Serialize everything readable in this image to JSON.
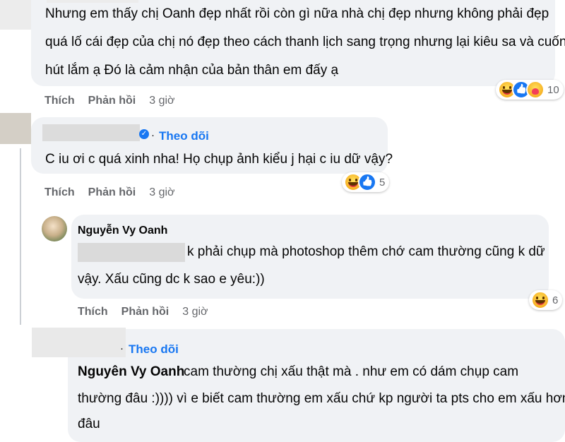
{
  "comments": [
    {
      "lines": [
        "Nhưng em thấy chị Oanh đẹp nhất rồi còn gì nữa nhà chị đẹp nhưng không phải đẹp",
        "quá lố cái đẹp của chị nó đẹp theo cách thanh lịch sang trọng nhưng lại kiêu sa và cuốn",
        "hút lắm ạ Đó là cảm nhận của bản thân em đấy ạ"
      ],
      "actions": {
        "like": "Thích",
        "reply": "Phản hồi",
        "time": "3 giờ"
      },
      "reactions": {
        "icons": [
          "haha-icon",
          "like-icon",
          "care-icon"
        ],
        "count": "10"
      }
    },
    {
      "follow": "Theo dõi",
      "text": "C iu ơi c quá xinh nha! Họ chụp ảnh kiểu j hại c iu dữ vậy?",
      "actions": {
        "like": "Thích",
        "reply": "Phản hồi",
        "time": "3 giờ"
      },
      "reactions": {
        "icons": [
          "haha-icon",
          "like-icon"
        ],
        "count": "5"
      }
    },
    {
      "name": "Nguyễn Vy Oanh",
      "line1": "k phải chụp mà photoshop thêm chớ cam thường cũng k dữ",
      "line2": "vậy. Xấu cũng dc k sao e yêu:))",
      "actions": {
        "like": "Thích",
        "reply": "Phản hồi",
        "time": "3 giờ"
      },
      "reactions": {
        "icons": [
          "haha-icon"
        ],
        "count": "6"
      }
    },
    {
      "follow": "Theo dõi",
      "mention": "Nguyên Vy Oanh",
      "line1": "cam thường chị xấu thật mà . như em có dám chụp cam",
      "line2": "thường đâu :)))) vì e biết cam thường em xấu chứ kp người ta pts cho em xấu hơn",
      "line3": "đâu"
    }
  ],
  "colors": {
    "link": "#1877f2",
    "bubble": "#f0f2f5",
    "meta": "#65676b"
  }
}
